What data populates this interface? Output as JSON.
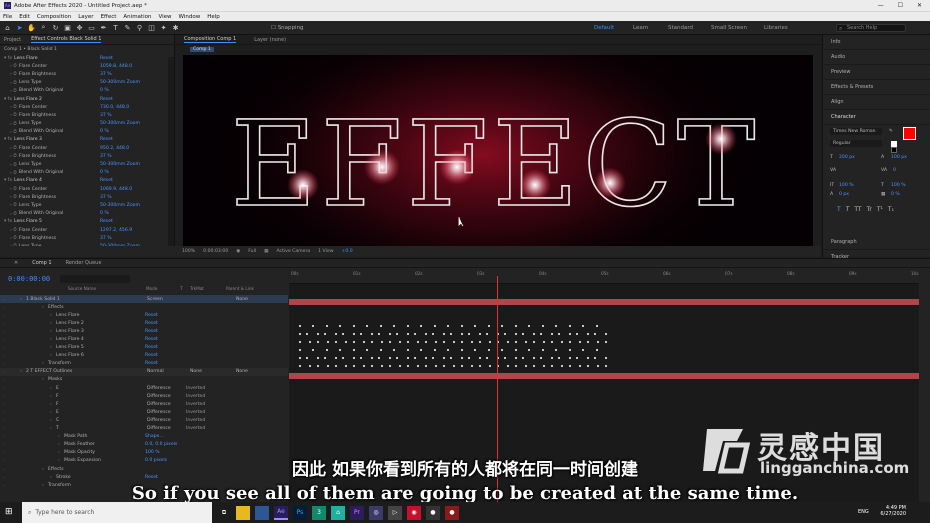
{
  "titlebar": {
    "title": "Adobe After Effects 2020 - Untitled Project.aep *"
  },
  "menu": [
    "File",
    "Edit",
    "Composition",
    "Layer",
    "Effect",
    "Animation",
    "View",
    "Window",
    "Help"
  ],
  "toolbar": {
    "snapping": "Snapping",
    "workspaces": [
      "Default",
      "Learn",
      "Standard",
      "Small Screen",
      "Libraries"
    ],
    "search_placeholder": "Search Help"
  },
  "left_panel": {
    "tabs": [
      "Project",
      "Effect Controls  Black Solid 1"
    ],
    "subtitle": "Comp 1 • Black Solid 1",
    "effects": [
      {
        "name": "Lens Flare",
        "reset": "Reset",
        "center": "1059.8, 448.0",
        "brightness": "37 %",
        "type": "50-300mm Zoom",
        "blend": "0 %"
      },
      {
        "name": "Lens Flare 2",
        "reset": "Reset",
        "center": "730.0, 448.0",
        "brightness": "37 %",
        "type": "50-300mm Zoom",
        "blend": "0 %"
      },
      {
        "name": "Lens Flare 3",
        "reset": "Reset",
        "center": "950.2, 448.0",
        "brightness": "37 %",
        "type": "50-300mm Zoom",
        "blend": "0 %"
      },
      {
        "name": "Lens Flare 4",
        "reset": "Reset",
        "center": "1069.9, 448.0",
        "brightness": "37 %",
        "type": "50-300mm Zoom",
        "blend": "0 %"
      },
      {
        "name": "Lens Flare 5",
        "reset": "Reset",
        "center": "1297.2, 456.9",
        "brightness": "37 %",
        "type": "50-300mm Zoom"
      }
    ],
    "labels": {
      "center": "Flare Center",
      "brightness": "Flare Brightness",
      "type": "Lens Type",
      "blend": "Blend With Original"
    }
  },
  "comp_panel": {
    "tabs": [
      "Composition Comp 1",
      "Layer (none)"
    ],
    "comp_tab": "Comp 1",
    "viewer_text": "EFFECT",
    "bottom": {
      "zoom": "100%",
      "time": "0:00:03:00",
      "quality": "Full",
      "camera": "Active Camera",
      "view": "1 View",
      "offset": "+0.0"
    }
  },
  "right_panel": {
    "items": [
      "Info",
      "Audio",
      "Preview",
      "Effects & Presets",
      "Align",
      "Character",
      "Paragraph",
      "Tracker"
    ],
    "font": "Times New Roman",
    "style": "Regular",
    "size": "200 px",
    "leading": "100 px",
    "color_fill": "#ff0000",
    "tracking": "0",
    "scale_v": "100 %",
    "scale_h": "100 %",
    "baseline": "0 px",
    "tsume": "0 %",
    "styles": [
      "T",
      "T",
      "TT",
      "Tr",
      "T¹",
      "T₁"
    ]
  },
  "timeline": {
    "tabs": [
      "Comp 1",
      "Render Queue"
    ],
    "timecode": "0:00:00:00",
    "columns": [
      "Source Name",
      "Mode",
      "T",
      "TrkMat",
      "Parent & Link"
    ],
    "ruler": [
      "00s",
      "01s",
      "02s",
      "03s",
      "04s",
      "05s",
      "06s",
      "07s",
      "08s",
      "09s",
      "10s"
    ],
    "layers": [
      {
        "indent": 26,
        "name": "1  Black Solid 1",
        "mode": "Screen",
        "parent": "None"
      },
      {
        "indent": 48,
        "name": "Effects"
      },
      {
        "indent": 56,
        "name": "Lens Flare",
        "reset": "Reset"
      },
      {
        "indent": 56,
        "name": "Lens Flare 2",
        "reset": "Reset"
      },
      {
        "indent": 56,
        "name": "Lens Flare 3",
        "reset": "Reset"
      },
      {
        "indent": 56,
        "name": "Lens Flare 4",
        "reset": "Reset"
      },
      {
        "indent": 56,
        "name": "Lens Flare 5",
        "reset": "Reset"
      },
      {
        "indent": 56,
        "name": "Lens Flare 6",
        "reset": "Reset"
      },
      {
        "indent": 48,
        "name": "Transform",
        "reset": "Reset"
      },
      {
        "indent": 26,
        "name": "2  T  EFFECT Outlines",
        "mode": "Normal",
        "trk": "None",
        "parent": "None"
      },
      {
        "indent": 48,
        "name": "Masks"
      },
      {
        "indent": 56,
        "name": "E",
        "mode": "Difference",
        "inv": "Inverted"
      },
      {
        "indent": 56,
        "name": "F",
        "mode": "Difference",
        "inv": "Inverted"
      },
      {
        "indent": 56,
        "name": "F",
        "mode": "Difference",
        "inv": "Inverted"
      },
      {
        "indent": 56,
        "name": "E",
        "mode": "Difference",
        "inv": "Inverted"
      },
      {
        "indent": 56,
        "name": "C",
        "mode": "Difference",
        "inv": "Inverted"
      },
      {
        "indent": 56,
        "name": "T",
        "mode": "Difference",
        "inv": "Inverted"
      },
      {
        "indent": 64,
        "name": "Mask Path",
        "rs": "Shape..."
      },
      {
        "indent": 64,
        "name": "Mask Feather",
        "rs": "0.0, 0.0 pixels"
      },
      {
        "indent": 64,
        "name": "Mask Opacity",
        "rs": "100 %"
      },
      {
        "indent": 64,
        "name": "Mask Expansion",
        "rs": "0.0 pixels"
      },
      {
        "indent": 48,
        "name": "Effects"
      },
      {
        "indent": 56,
        "name": "Stroke",
        "reset": "Reset"
      },
      {
        "indent": 48,
        "name": "Transform"
      }
    ]
  },
  "subtitles": {
    "cn": "因此 如果你看到所有的人都将在同一时间创建",
    "en": "So if you see all of them are going to be created at the same time."
  },
  "watermark": {
    "brand": "灵感中国",
    "url": "lingganchina.com"
  },
  "taskbar": {
    "search_placeholder": "Type here to search",
    "lang": "ENG",
    "time": "4:49 PM",
    "date": "6/27/2020"
  },
  "colors": {
    "accent": "#3d8eff",
    "playhead": "#e03030",
    "layer_bar": "#b0454a"
  }
}
